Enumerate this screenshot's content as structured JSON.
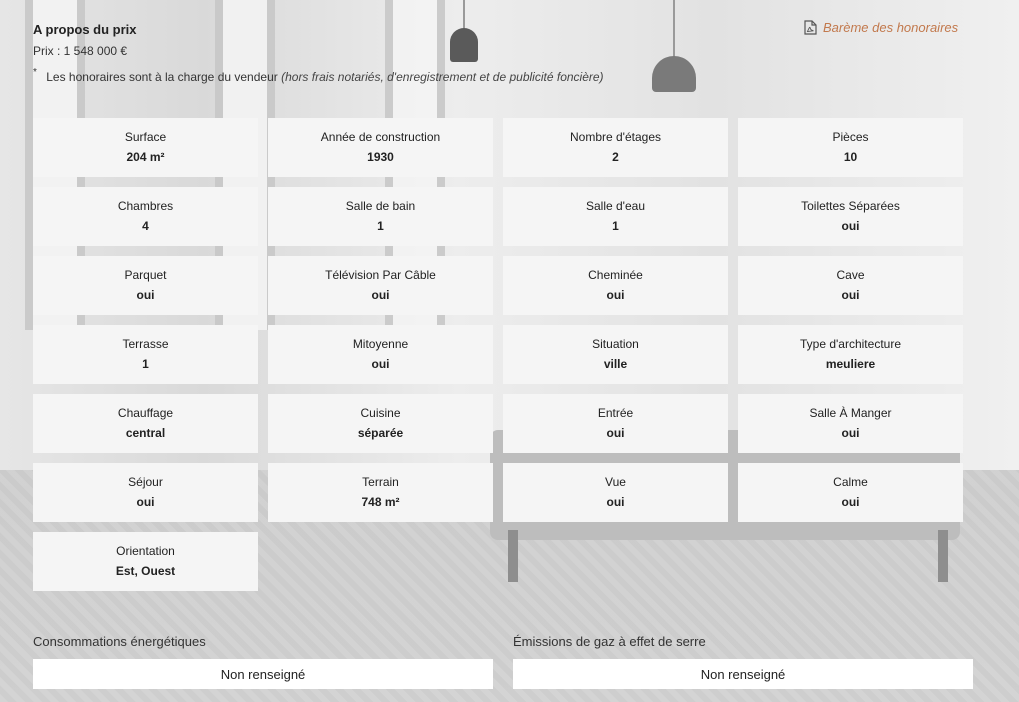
{
  "about": {
    "title": "A propos du prix",
    "price": "Prix : 1 548 000 €",
    "fees_star": "*",
    "fees_text": "Les honoraires sont à la charge du vendeur",
    "fees_detail": "(hors frais notariés, d'enregistrement et de publicité foncière)"
  },
  "bareme": {
    "label": "Barème des honoraires",
    "icon": "pdf-file-icon",
    "color": "#c2794d"
  },
  "features": [
    {
      "label": "Surface",
      "value": "204 m²"
    },
    {
      "label": "Année de construction",
      "value": "1930"
    },
    {
      "label": "Nombre d'étages",
      "value": "2"
    },
    {
      "label": "Pièces",
      "value": "10"
    },
    {
      "label": "Chambres",
      "value": "4"
    },
    {
      "label": "Salle de bain",
      "value": "1"
    },
    {
      "label": "Salle d'eau",
      "value": "1"
    },
    {
      "label": "Toilettes Séparées",
      "value": "oui"
    },
    {
      "label": "Parquet",
      "value": "oui"
    },
    {
      "label": "Télévision Par Câble",
      "value": "oui"
    },
    {
      "label": "Cheminée",
      "value": "oui"
    },
    {
      "label": "Cave",
      "value": "oui"
    },
    {
      "label": "Terrasse",
      "value": "1"
    },
    {
      "label": "Mitoyenne",
      "value": "oui"
    },
    {
      "label": "Situation",
      "value": "ville"
    },
    {
      "label": "Type d'architecture",
      "value": "meuliere"
    },
    {
      "label": "Chauffage",
      "value": "central"
    },
    {
      "label": "Cuisine",
      "value": "séparée"
    },
    {
      "label": "Entrée",
      "value": "oui"
    },
    {
      "label": "Salle À Manger",
      "value": "oui"
    },
    {
      "label": "Séjour",
      "value": "oui"
    },
    {
      "label": "Terrain",
      "value": "748 m²"
    },
    {
      "label": "Vue",
      "value": "oui"
    },
    {
      "label": "Calme",
      "value": "oui"
    },
    {
      "label": "Orientation",
      "value": "Est, Ouest"
    }
  ],
  "energy": {
    "consumption_label": "Consommations énergétiques",
    "consumption_value": "Non renseigné",
    "emissions_label": "Émissions de gaz à effet de serre",
    "emissions_value": "Non renseigné"
  }
}
